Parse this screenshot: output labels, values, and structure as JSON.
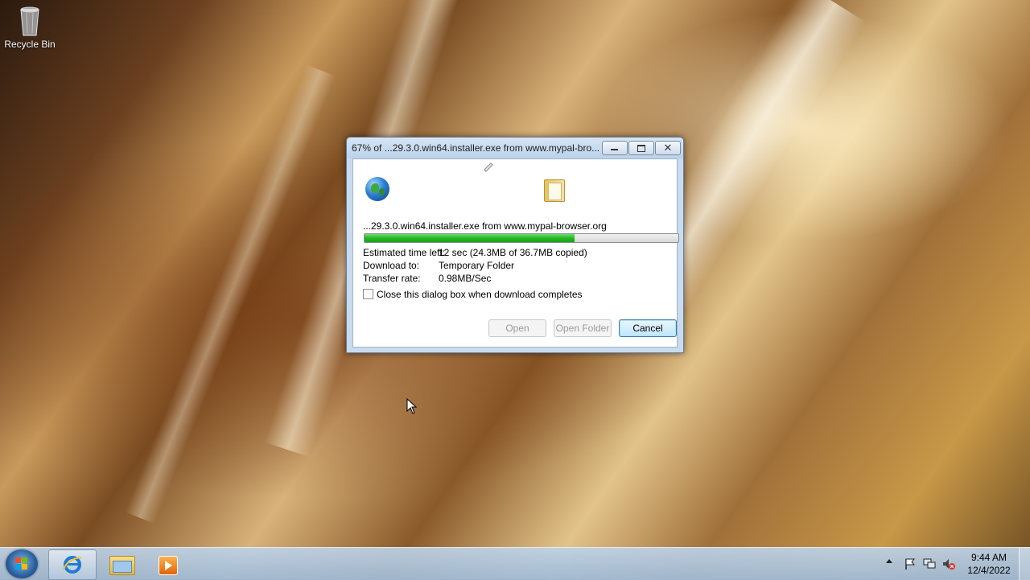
{
  "desktop": {
    "icons": [
      {
        "label": "Recycle Bin",
        "icon": "recycle-bin-icon"
      }
    ]
  },
  "dialog": {
    "title": "67% of ...29.3.0.win64.installer.exe from www.mypal-bro...",
    "filename": "...29.3.0.win64.installer.exe from www.mypal-browser.org",
    "progress": 0.67,
    "estimated_time_label": "Estimated time left:",
    "estimated_time_value": "12 sec (24.3MB of 36.7MB copied)",
    "download_to_label": "Download to:",
    "download_to_value": "Temporary Folder",
    "transfer_rate_label": "Transfer rate:",
    "transfer_rate_value": "0.98MB/Sec",
    "close_checkbox_label": "Close this dialog box when download completes",
    "close_checkbox_checked": false,
    "buttons": {
      "open": "Open",
      "open_folder": "Open Folder",
      "cancel": "Cancel"
    }
  },
  "taskbar": {
    "apps": [
      {
        "name": "Internet Explorer",
        "icon": "internet-explorer-icon",
        "active": true
      },
      {
        "name": "Windows Explorer",
        "icon": "folder-explorer-icon",
        "active": false
      },
      {
        "name": "Windows Media Player",
        "icon": "media-player-icon",
        "active": false
      }
    ],
    "tray_icons": [
      "show-hidden-icons-arrow",
      "action-center-flag-icon",
      "network-icon",
      "volume-muted-icon"
    ],
    "time": "9:44 AM",
    "date": "12/4/2022"
  },
  "colors": {
    "progress_fill": "#22b422",
    "cancel_border": "#3c7fb1"
  }
}
